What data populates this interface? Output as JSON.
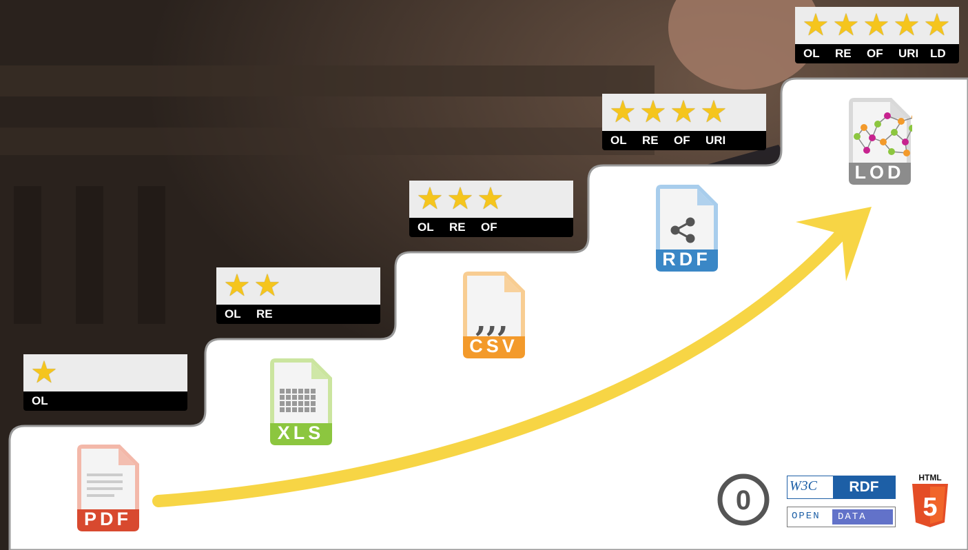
{
  "badges": [
    {
      "stars": 1,
      "labels": [
        "OL"
      ]
    },
    {
      "stars": 2,
      "labels": [
        "OL",
        "RE"
      ]
    },
    {
      "stars": 3,
      "labels": [
        "OL",
        "RE",
        "OF"
      ]
    },
    {
      "stars": 4,
      "labels": [
        "OL",
        "RE",
        "OF",
        "URI"
      ]
    },
    {
      "stars": 5,
      "labels": [
        "OL",
        "RE",
        "OF",
        "URI",
        "LD"
      ]
    }
  ],
  "star_glyph": "★",
  "formats": [
    {
      "name": "PDF",
      "color": "#d8492f",
      "light": "#f3b8a9"
    },
    {
      "name": "XLS",
      "color": "#8cc63f",
      "light": "#cbe59f"
    },
    {
      "name": "CSV",
      "color": "#f39a2b",
      "light": "#f8cd92"
    },
    {
      "name": "RDF",
      "color": "#3a87c6",
      "light": "#a8cdec"
    },
    {
      "name": "LOD",
      "color": "#8c8c8c",
      "light": "#d9d9d9"
    }
  ],
  "colors": {
    "arrow": "#f7d545",
    "star": "#f5c51d",
    "background_dark": "#2a221d",
    "steps": "#ffffff"
  },
  "logos": {
    "cc0": "0",
    "w3c": "W3C",
    "rdf": "RDF",
    "open": "OPEN",
    "data": "DATA",
    "html": "HTML",
    "html5_digit": "5"
  }
}
